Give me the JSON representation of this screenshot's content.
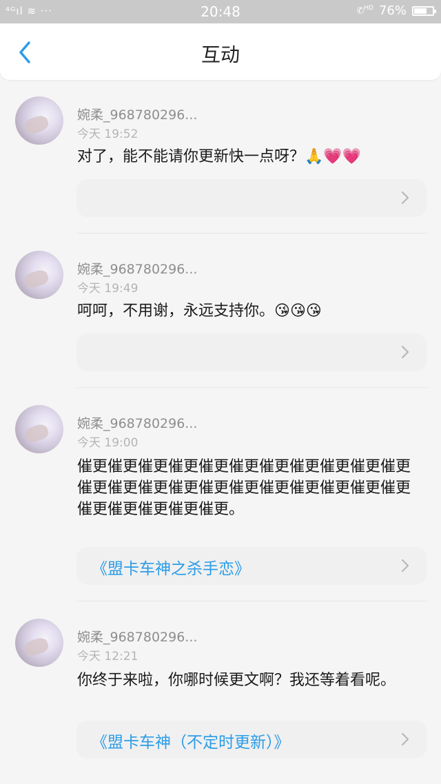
{
  "status_bar": {
    "left_icons": "⁴ᴳıl ≋ ···",
    "time": "20:48",
    "hd_label": "HD",
    "battery": "76%",
    "battery_level": 0.76
  },
  "nav": {
    "title": "互动",
    "back_icon": "chevron-left-icon"
  },
  "comments": [
    {
      "user": "婉柔_968780296...",
      "time": "今天 19:52",
      "text": "对了，能不能请你更新快一点呀？",
      "emoji": "🙏💗💗",
      "link": ""
    },
    {
      "user": "婉柔_968780296...",
      "time": "今天 19:49",
      "text": "呵呵，不用谢，永远支持你。",
      "emoji": "😘😘😘",
      "link": ""
    },
    {
      "user": "婉柔_968780296...",
      "time": "今天 19:00",
      "text": "催更催更催更催更催更催更催更催更催更催更催更催更催更催更催更催更催更催更催更催更催更催更催更催更催更催更催更。",
      "emoji": "",
      "link": "《盟卡车神之杀手恋》"
    },
    {
      "user": "婉柔_968780296...",
      "time": "今天 12:21",
      "text": "你终于来啦，你哪时候更文啊？我还等着看呢。",
      "emoji": "",
      "link": "《盟卡车神（不定时更新）》"
    }
  ],
  "colors": {
    "accent": "#2b9ce8",
    "statusbar_bg": "#c9c9c9"
  }
}
